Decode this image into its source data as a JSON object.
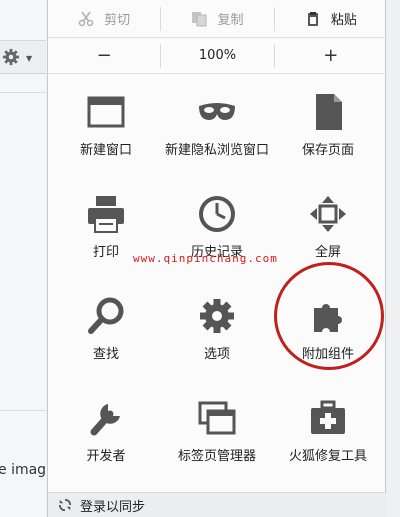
{
  "edit": {
    "cut_label": "剪切",
    "copy_label": "复制",
    "paste_label": "粘贴"
  },
  "zoom": {
    "minus": "−",
    "level": "100%",
    "plus": "+"
  },
  "tiles": [
    {
      "label": "新建窗口",
      "icon": "window-icon"
    },
    {
      "label": "新建隐私浏览窗口",
      "icon": "private-mask-icon"
    },
    {
      "label": "保存页面",
      "icon": "page-icon"
    },
    {
      "label": "打印",
      "icon": "printer-icon"
    },
    {
      "label": "历史记录",
      "icon": "clock-icon"
    },
    {
      "label": "全屏",
      "icon": "fullscreen-arrows-icon"
    },
    {
      "label": "查找",
      "icon": "magnifier-icon"
    },
    {
      "label": "选项",
      "icon": "gear-icon"
    },
    {
      "label": "附加组件",
      "icon": "puzzle-icon"
    },
    {
      "label": "开发者",
      "icon": "wrench-icon"
    },
    {
      "label": "标签页管理器",
      "icon": "tabs-icon"
    },
    {
      "label": "火狐修复工具",
      "icon": "first-aid-kit-icon"
    }
  ],
  "footer": {
    "sync_label": "登录以同步"
  },
  "watermark": "www.qinpinchang.com",
  "background": {
    "partial_text": "e imag"
  },
  "colors": {
    "icon": "#555555",
    "highlight": "#c0201a",
    "watermark": "#e01919"
  }
}
